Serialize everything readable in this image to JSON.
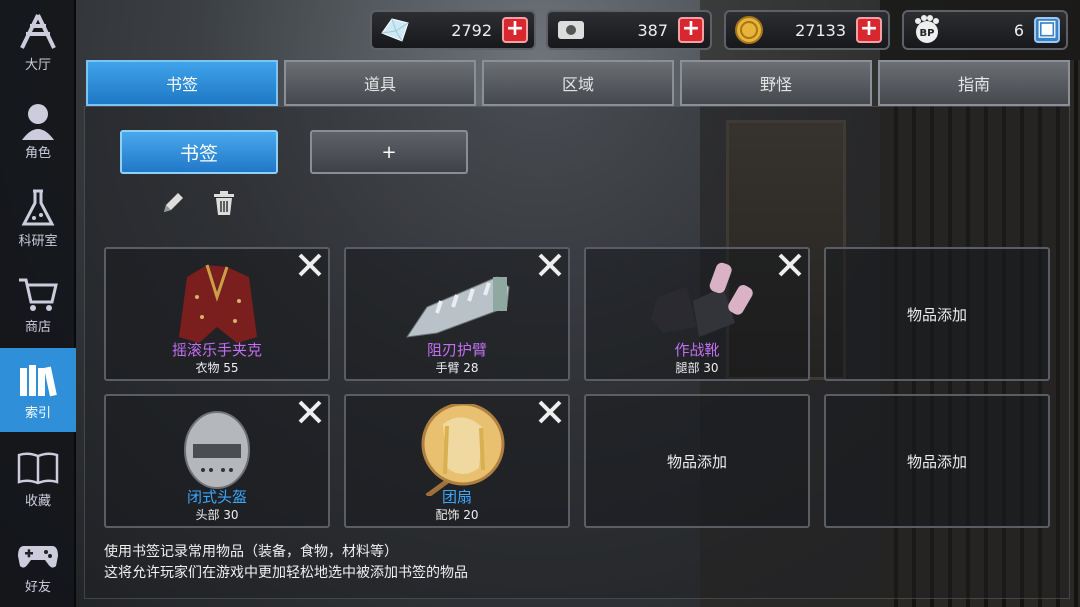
{
  "sidebar": {
    "items": [
      {
        "label": "大厅",
        "icon": "lobby-icon"
      },
      {
        "label": "角色",
        "icon": "character-icon"
      },
      {
        "label": "科研室",
        "icon": "flask-icon"
      },
      {
        "label": "商店",
        "icon": "cart-icon"
      },
      {
        "label": "索引",
        "icon": "books-icon",
        "active": true
      },
      {
        "label": "收藏",
        "icon": "book-icon"
      },
      {
        "label": "好友",
        "icon": "gamepad-icon"
      }
    ]
  },
  "currencies": [
    {
      "icon": "diamond-icon",
      "value": "2792"
    },
    {
      "icon": "ticket-icon",
      "value": "387"
    },
    {
      "icon": "coin-icon",
      "value": "27133"
    },
    {
      "icon": "bp-icon",
      "value": "6"
    }
  ],
  "tabs": [
    "书签",
    "道具",
    "区域",
    "野怪",
    "指南"
  ],
  "bookmark_button": "书签",
  "add_button": "+",
  "items": [
    {
      "name": "摇滚乐手夹克",
      "detail": "衣物 55",
      "rarity": "purple"
    },
    {
      "name": "阻刃护臂",
      "detail": "手臂 28",
      "rarity": "purple"
    },
    {
      "name": "作战靴",
      "detail": "腿部 30",
      "rarity": "purple"
    },
    {
      "empty": "物品添加"
    },
    {
      "name": "闭式头盔",
      "detail": "头部 30",
      "rarity": "blue"
    },
    {
      "name": "团扇",
      "detail": "配饰 20",
      "rarity": "blue"
    },
    {
      "empty": "物品添加"
    },
    {
      "empty": "物品添加"
    }
  ],
  "info_line1": "使用书签记录常用物品（装备，食物，材料等）",
  "info_line2": "这将允许玩家们在游戏中更加轻松地选中被添加书签的物品",
  "colors": {
    "accent": "#2f8fd8",
    "epic": "#c070f0",
    "rare": "#3aa8ff",
    "danger": "#d9272f"
  }
}
